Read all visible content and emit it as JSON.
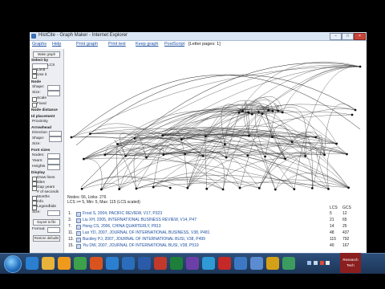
{
  "window": {
    "title": "HistCite - Graph Maker - Internet Explorer"
  },
  "menu": {
    "graphs": "Graphs",
    "help": "Help",
    "print_graph": "Print graph",
    "print_text": "Print text",
    "keep_graph": "Keep graph",
    "postscript": "PostScript",
    "letter_pages": "[Letter pages: 1]"
  },
  "sidebar": {
    "make_graph": "Make graph",
    "select_by": "Select by",
    "select_value": "LCS",
    "limit_label": "Limit",
    "use_it": "Use it",
    "node": "Node",
    "shape": "Shape:",
    "size": "Size:",
    "scale": "Scale",
    "fixed": "Fixed",
    "node_distance": "Node distance",
    "id_placement": "Id placement",
    "proximity": "Proximity",
    "arrowhead": "Arrowhead",
    "direction": "Direction",
    "font_sizes": "Font sizes",
    "nodes": "Nodes:",
    "years": "Years:",
    "heights": "Heights",
    "display": "Display",
    "draw_lines": "Draw lines",
    "titles": "titles",
    "gap_years": "Gap years",
    "seconds": "# of seconds",
    "months": "Months",
    "info": "Info",
    "legend": "Legend",
    "hide": "hide",
    "size2": "Size:",
    "export_btn": "Export to file",
    "format": "Format:",
    "restore_btn": "Restore defaults"
  },
  "status": {
    "nodes_links": "Nodes: 56, Links: 276",
    "lcs_scale": "LCS >= 5, Min: 5, Max: 115 (LCS scaled)",
    "col_lcs": "LCS",
    "col_gcs": "GCS"
  },
  "refs": [
    {
      "n": "1.",
      "text": "Frost S, 2004, PACIFIC REVIEW, V17, P323",
      "lcs": "5",
      "gcs": "12"
    },
    {
      "n": "3.",
      "text": "Liu XH, 2005, INTERNATIONAL BUSINESS REVIEW, V14, P47",
      "lcs": "21",
      "gcs": "65"
    },
    {
      "n": "7.",
      "text": "Hong CS, 2006, CHINA QUARTERLY, P813",
      "lcs": "14",
      "gcs": "25"
    },
    {
      "n": "11.",
      "text": "Luo YD, 2007, JOURNAL OF INTERNATIONAL BUSINESS, V38, P481",
      "lcs": "48",
      "gcs": "437"
    },
    {
      "n": "13.",
      "text": "Buckley PJ, 2007, JOURNAL OF INTERNATIONAL BUSI, V38, P499",
      "lcs": "115",
      "gcs": "792"
    },
    {
      "n": "15.",
      "text": "Yiu DW, 2007, JOURNAL OF INTERNATIONAL BUSI, V38, P519",
      "lcs": "40",
      "gcs": "167"
    }
  ],
  "taskbar_icons": [
    "start-orb",
    "ie-icon",
    "explorer-icon",
    "media-icon",
    "chrome-icon",
    "firefox-icon",
    "ie2-icon",
    "outlook-icon",
    "word-icon",
    "powerpoint-icon",
    "excel-icon",
    "vs-icon",
    "photoshop-icon",
    "acrobat-icon",
    "notepad-icon",
    "app-icon",
    "app2-icon",
    "app3-icon"
  ]
}
